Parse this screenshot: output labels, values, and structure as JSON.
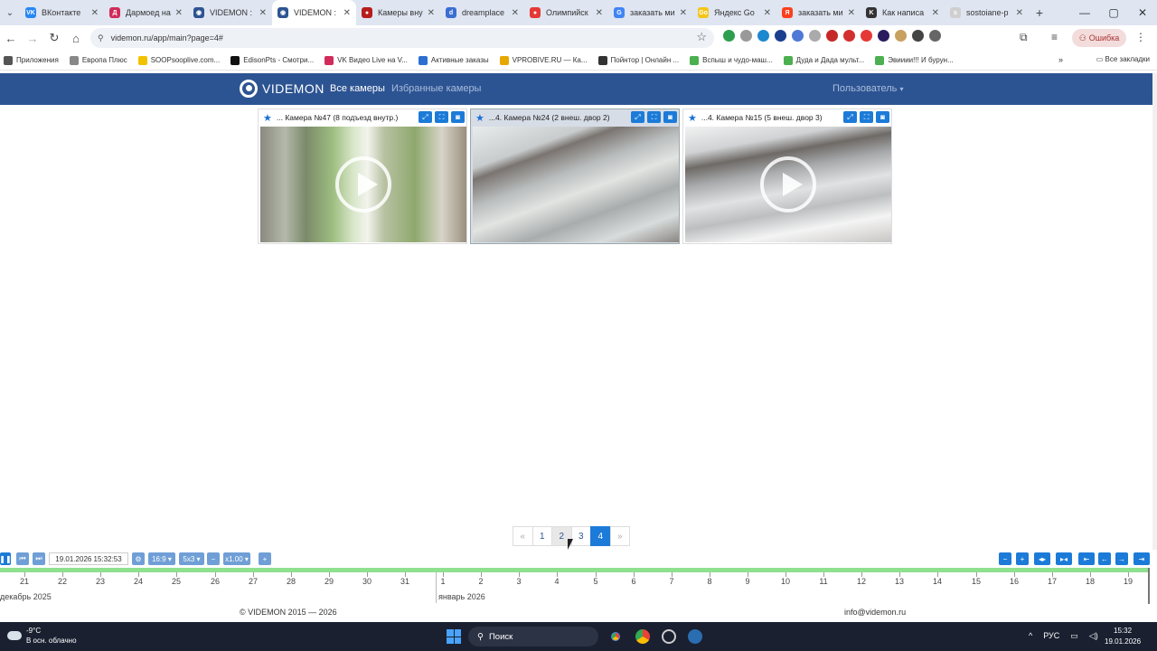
{
  "browser": {
    "tabs": [
      {
        "title": "ВКонтакте",
        "icon": "vk-icon",
        "color": "#2787f5",
        "glyph": "VK",
        "active": false
      },
      {
        "title": "Дармоед на",
        "icon": "darmoed-icon",
        "color": "#d02b5a",
        "glyph": "Д",
        "active": false
      },
      {
        "title": "VIDEMON :",
        "icon": "videmon-icon",
        "color": "#2d5492",
        "glyph": "◉",
        "active": false
      },
      {
        "title": "VIDEMON :",
        "icon": "videmon-icon",
        "color": "#2d5492",
        "glyph": "◉",
        "active": true
      },
      {
        "title": "Камеры вну",
        "icon": "camera-site-icon",
        "color": "#b71c1c",
        "glyph": "●",
        "active": false
      },
      {
        "title": "dreamplace",
        "icon": "dreamplace-icon",
        "color": "#3a6ed0",
        "glyph": "d",
        "active": false
      },
      {
        "title": "Олимпийск",
        "icon": "map-pin-icon",
        "color": "#e53935",
        "glyph": "●",
        "active": false
      },
      {
        "title": "заказать ми",
        "icon": "google-icon",
        "color": "#4285f4",
        "glyph": "G",
        "active": false
      },
      {
        "title": "Яндекс Go",
        "icon": "yandex-go-icon",
        "color": "#f5c518",
        "glyph": "Go",
        "active": false
      },
      {
        "title": "заказать ми",
        "icon": "yandex-icon",
        "color": "#fc3f1d",
        "glyph": "Я",
        "active": false
      },
      {
        "title": "Как написа",
        "icon": "book-icon",
        "color": "#333333",
        "glyph": "K",
        "active": false
      },
      {
        "title": "sostoiane-p",
        "icon": "page-icon",
        "color": "#cfcfcf",
        "glyph": "s",
        "active": false
      }
    ],
    "url": "videmon.ru/app/main?page=4#",
    "error_label": "Ошибка",
    "bookmarks": [
      {
        "label": "Приложения",
        "color": "#555555"
      },
      {
        "label": "Европа Плюс",
        "color": "#888888"
      },
      {
        "label": "SOOPsooplive.com...",
        "color": "#f2c200"
      },
      {
        "label": "EdisonPts - Смотри...",
        "color": "#111111"
      },
      {
        "label": "VK Видео Live на V...",
        "color": "#d02b5a"
      },
      {
        "label": "Активные заказы",
        "color": "#2d6fd0"
      },
      {
        "label": "VPROBIVE.RU — Ка...",
        "color": "#e6a800"
      },
      {
        "label": "Пойнтор | Онлайн ...",
        "color": "#333333"
      },
      {
        "label": "Вспыш и чудо-маш...",
        "color": "#4caf50"
      },
      {
        "label": "Дуда и Дада мульт...",
        "color": "#4caf50"
      },
      {
        "label": "Эвииии!!! И бурун...",
        "color": "#4caf50"
      }
    ],
    "all_bookmarks": "Все закладки"
  },
  "site": {
    "logo": "VIDEMON",
    "nav_all": "Все камеры",
    "nav_favorites": "Избранные камеры",
    "nav_user": "Пользователь"
  },
  "cameras": [
    {
      "title": "... Камера №47 (8 подъезд внутр.)",
      "selected": false,
      "playing": false
    },
    {
      "title": "...4. Камера №24 (2 внеш. двор 2)",
      "selected": true,
      "playing": true
    },
    {
      "title": "...4. Камера №15 (5 внеш. двор 3)",
      "selected": false,
      "playing": false
    }
  ],
  "pagination": {
    "prev": "«",
    "pages": [
      "1",
      "2",
      "3",
      "4"
    ],
    "current": "4",
    "hover": "2",
    "next": "»"
  },
  "player": {
    "datetime": "19.01.2026 15:32:53",
    "aspect": "16:9",
    "grid": "5x3",
    "speed": "x1.00"
  },
  "timeline": {
    "days": [
      "21",
      "22",
      "23",
      "24",
      "25",
      "26",
      "27",
      "28",
      "29",
      "30",
      "31",
      "1",
      "2",
      "3",
      "4",
      "5",
      "6",
      "7",
      "8",
      "9",
      "10",
      "11",
      "12",
      "13",
      "14",
      "15",
      "16",
      "17",
      "18",
      "19"
    ],
    "month_1": "декабрь 2025",
    "month_2": "январь 2026"
  },
  "footer": {
    "copyright": "© VIDEMON 2015 — 2026",
    "email": "info@videmon.ru"
  },
  "taskbar": {
    "temperature": "-9°C",
    "weather": "В осн. облачно",
    "search": "Поиск",
    "lang": "РУС",
    "time": "15:32",
    "date": "19.01.2026"
  }
}
